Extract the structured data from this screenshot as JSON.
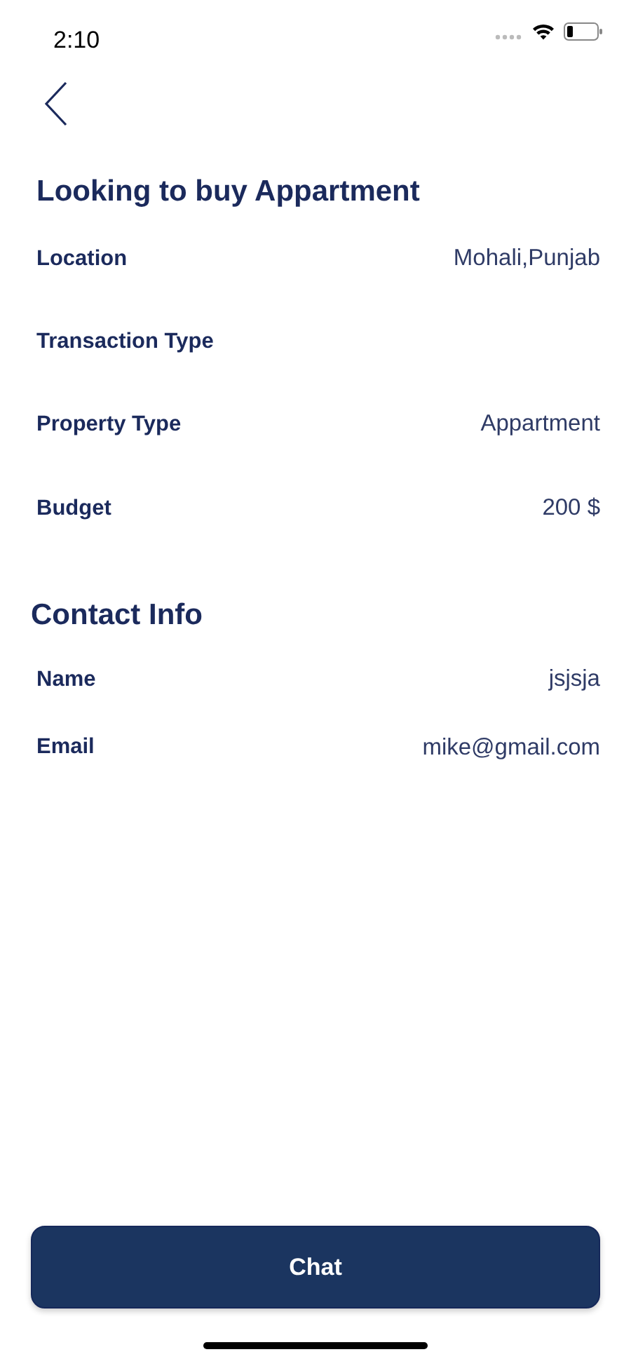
{
  "status_bar": {
    "time": "2:10"
  },
  "requirement": {
    "title": "Looking to buy Appartment",
    "rows": [
      {
        "label": "Location",
        "value": "Mohali,Punjab"
      },
      {
        "label": "Transaction Type"
      },
      {
        "label": "Property Type",
        "value": "Appartment"
      },
      {
        "label": "Budget",
        "value": "200 $"
      }
    ]
  },
  "contact": {
    "title": "Contact Info",
    "rows": [
      {
        "label": "Name",
        "value": "jsjsja"
      },
      {
        "label": "Email",
        "value": "mike@gmail.com"
      }
    ]
  },
  "button": "Chat"
}
